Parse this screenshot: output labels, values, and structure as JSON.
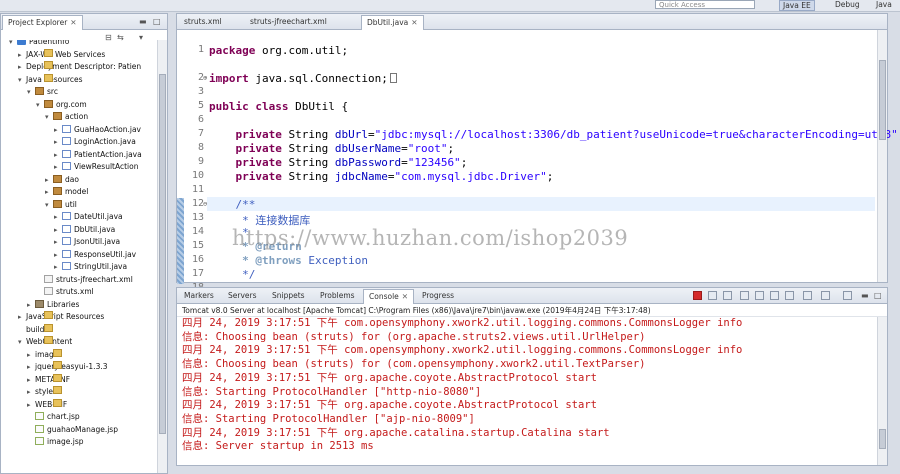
{
  "topbar": {
    "quick_access": "Quick Access",
    "perspectives": [
      "Java EE",
      "Debug",
      "Java"
    ]
  },
  "explorer": {
    "tab_label": "Project Explorer",
    "items": [
      {
        "label": "PatientInfo",
        "icon": "project-icon"
      },
      {
        "label": "JAX-WS Web Services",
        "icon": "folder-icon"
      },
      {
        "label": "Deployment Descriptor: Patien",
        "icon": "folder-icon"
      },
      {
        "label": "Java Resources",
        "icon": "folder-icon"
      },
      {
        "label": "src",
        "icon": "package-icon"
      },
      {
        "label": "org.com",
        "icon": "package-icon"
      },
      {
        "label": "action",
        "icon": "package-icon"
      },
      {
        "label": "GuaHaoAction.jav",
        "icon": "java-file-icon"
      },
      {
        "label": "LoginAction.java",
        "icon": "java-file-icon"
      },
      {
        "label": "PatientAction.java",
        "icon": "java-file-icon"
      },
      {
        "label": "ViewResultAction",
        "icon": "java-file-icon"
      },
      {
        "label": "dao",
        "icon": "package-icon"
      },
      {
        "label": "model",
        "icon": "package-icon"
      },
      {
        "label": "util",
        "icon": "package-icon"
      },
      {
        "label": "DateUtil.java",
        "icon": "java-file-icon"
      },
      {
        "label": "DbUtil.java",
        "icon": "java-file-icon"
      },
      {
        "label": "JsonUtil.java",
        "icon": "java-file-icon"
      },
      {
        "label": "ResponseUtil.jav",
        "icon": "java-file-icon"
      },
      {
        "label": "StringUtil.java",
        "icon": "java-file-icon"
      },
      {
        "label": "struts-jfreechart.xml",
        "icon": "xml-file-icon"
      },
      {
        "label": "struts.xml",
        "icon": "xml-file-icon"
      },
      {
        "label": "Libraries",
        "icon": "library-icon"
      },
      {
        "label": "JavaScript Resources",
        "icon": "folder-icon"
      },
      {
        "label": "build",
        "icon": "folder-icon"
      },
      {
        "label": "WebContent",
        "icon": "folder-icon"
      },
      {
        "label": "images",
        "icon": "folder-icon"
      },
      {
        "label": "jquery-easyui-1.3.3",
        "icon": "folder-icon"
      },
      {
        "label": "META-INF",
        "icon": "folder-icon"
      },
      {
        "label": "style",
        "icon": "folder-icon"
      },
      {
        "label": "WEB-INF",
        "icon": "folder-icon"
      },
      {
        "label": "chart.jsp",
        "icon": "jsp-file-icon"
      },
      {
        "label": "guahaoManage.jsp",
        "icon": "jsp-file-icon"
      },
      {
        "label": "image.jsp",
        "icon": "jsp-file-icon"
      }
    ]
  },
  "editor": {
    "tabs": [
      {
        "label": "struts.xml"
      },
      {
        "label": "struts-jfreechart.xml"
      },
      {
        "label": "DbUtil.java"
      }
    ],
    "line_numbers": [
      "1",
      "2",
      "3",
      "5",
      "6",
      "7",
      "8",
      "9",
      "10",
      "11",
      "12",
      "13",
      "14",
      "15",
      "16",
      "17",
      "18"
    ],
    "code": {
      "l1_kw": "package",
      "l1_rest": " org.com.util;",
      "l3_kw": "import",
      "l3_rest": " java.sql.Connection;",
      "l5_kw1": "public",
      "l5_kw2": "class",
      "l5_rest": " DbUtil {",
      "l7_kw": "private",
      "l7_type": " String ",
      "l7_field": "dbUrl",
      "l7_eq": "=",
      "l7_str": "\"jdbc:mysql://localhost:3306/db_patient?useUnicode=true&characterEncoding=utf8\"",
      "l7_end": ";",
      "l8_kw": "private",
      "l8_type": " String ",
      "l8_field": "dbUserName",
      "l8_eq": "=",
      "l8_str": "\"root\"",
      "l8_end": ";",
      "l9_kw": "private",
      "l9_type": " String ",
      "l9_field": "dbPassword",
      "l9_eq": "=",
      "l9_str": "\"123456\"",
      "l9_end": ";",
      "l10_kw": "private",
      "l10_type": " String ",
      "l10_field": "jdbcName",
      "l10_eq": "=",
      "l10_str": "\"com.mysql.jdbc.Driver\"",
      "l10_end": ";",
      "l12": "/**",
      "l13": " * 连接数据库",
      "l14": " *",
      "l15_tag": " * @return",
      "l16_tag": " * @throws",
      "l16_rest": " Exception",
      "l17": " */"
    }
  },
  "console_panel": {
    "tabs": [
      {
        "label": "Markers"
      },
      {
        "label": "Servers"
      },
      {
        "label": "Snippets"
      },
      {
        "label": "Problems"
      },
      {
        "label": "Console"
      },
      {
        "label": "Progress"
      }
    ],
    "header": "Tomcat v8.0 Server at localhost [Apache Tomcat] C:\\Program Files (x86)\\Java\\jre7\\bin\\javaw.exe (2019年4月24日 下午3:17:48)",
    "lines": [
      "四月 24, 2019 3:17:51 下午 com.opensymphony.xwork2.util.logging.commons.CommonsLogger info",
      "信息: Choosing bean (struts) for (org.apache.struts2.views.util.UrlHelper)",
      "四月 24, 2019 3:17:51 下午 com.opensymphony.xwork2.util.logging.commons.CommonsLogger info",
      "信息: Choosing bean (struts) for (com.opensymphony.xwork2.util.TextParser)",
      "四月 24, 2019 3:17:51 下午 org.apache.coyote.AbstractProtocol start",
      "信息: Starting ProtocolHandler [\"http-nio-8080\"]",
      "四月 24, 2019 3:17:51 下午 org.apache.coyote.AbstractProtocol start",
      "信息: Starting ProtocolHandler [\"ajp-nio-8009\"]",
      "四月 24, 2019 3:17:51 下午 org.apache.catalina.startup.Catalina start",
      "信息: Server startup in 2513 ms"
    ]
  },
  "watermark": "https://www.huzhan.com/ishop2039"
}
